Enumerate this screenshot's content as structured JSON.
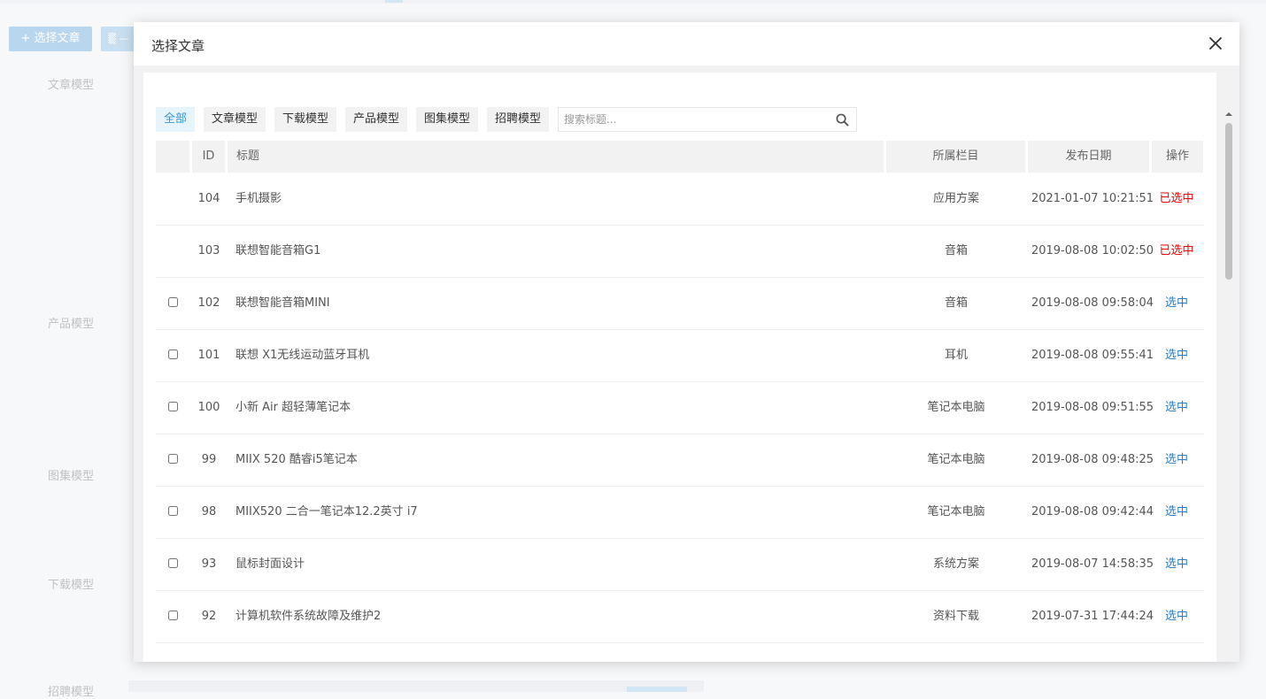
{
  "background": {
    "add_article_button": "+ 选择文章",
    "section_labels": [
      "文章模型",
      "产品模型",
      "图集模型",
      "下载模型",
      "招聘模型"
    ]
  },
  "modal": {
    "title": "选择文章",
    "close_icon": "close-icon",
    "filter_tabs": [
      "全部",
      "文章模型",
      "下载模型",
      "产品模型",
      "图集模型",
      "招聘模型"
    ],
    "active_tab": "全部",
    "search": {
      "placeholder": "搜索标题...",
      "value": "",
      "icon": "search-icon"
    },
    "table": {
      "headers": {
        "id": "ID",
        "title": "标题",
        "column": "所属栏目",
        "date": "发布日期",
        "action": "操作"
      },
      "rows": [
        {
          "id": "104",
          "title": "手机摄影",
          "column": "应用方案",
          "date": "2021-01-07 10:21:51",
          "action": "已选中",
          "selected": true
        },
        {
          "id": "103",
          "title": "联想智能音箱G1",
          "column": "音箱",
          "date": "2019-08-08 10:02:50",
          "action": "已选中",
          "selected": true
        },
        {
          "id": "102",
          "title": "联想智能音箱MINI",
          "column": "音箱",
          "date": "2019-08-08 09:58:04",
          "action": "选中",
          "selected": false
        },
        {
          "id": "101",
          "title": "联想 X1无线运动蓝牙耳机",
          "column": "耳机",
          "date": "2019-08-08 09:55:41",
          "action": "选中",
          "selected": false
        },
        {
          "id": "100",
          "title": "小新 Air 超轻薄笔记本",
          "column": "笔记本电脑",
          "date": "2019-08-08 09:51:55",
          "action": "选中",
          "selected": false
        },
        {
          "id": "99",
          "title": "MIIX 520 酷睿i5笔记本",
          "column": "笔记本电脑",
          "date": "2019-08-08 09:48:25",
          "action": "选中",
          "selected": false
        },
        {
          "id": "98",
          "title": "MIIX520 二合一笔记本12.2英寸 i7",
          "column": "笔记本电脑",
          "date": "2019-08-08 09:42:44",
          "action": "选中",
          "selected": false
        },
        {
          "id": "93",
          "title": "鼠标封面设计",
          "column": "系统方案",
          "date": "2019-08-07 14:58:35",
          "action": "选中",
          "selected": false
        },
        {
          "id": "92",
          "title": "计算机软件系统故障及维护2",
          "column": "资料下载",
          "date": "2019-07-31 17:44:24",
          "action": "选中",
          "selected": false
        }
      ]
    }
  },
  "colors": {
    "accent": "#3a98d8",
    "selected_text": "#e60000",
    "select_link": "#2b7cc4",
    "header_bg": "#f2f2f2"
  }
}
